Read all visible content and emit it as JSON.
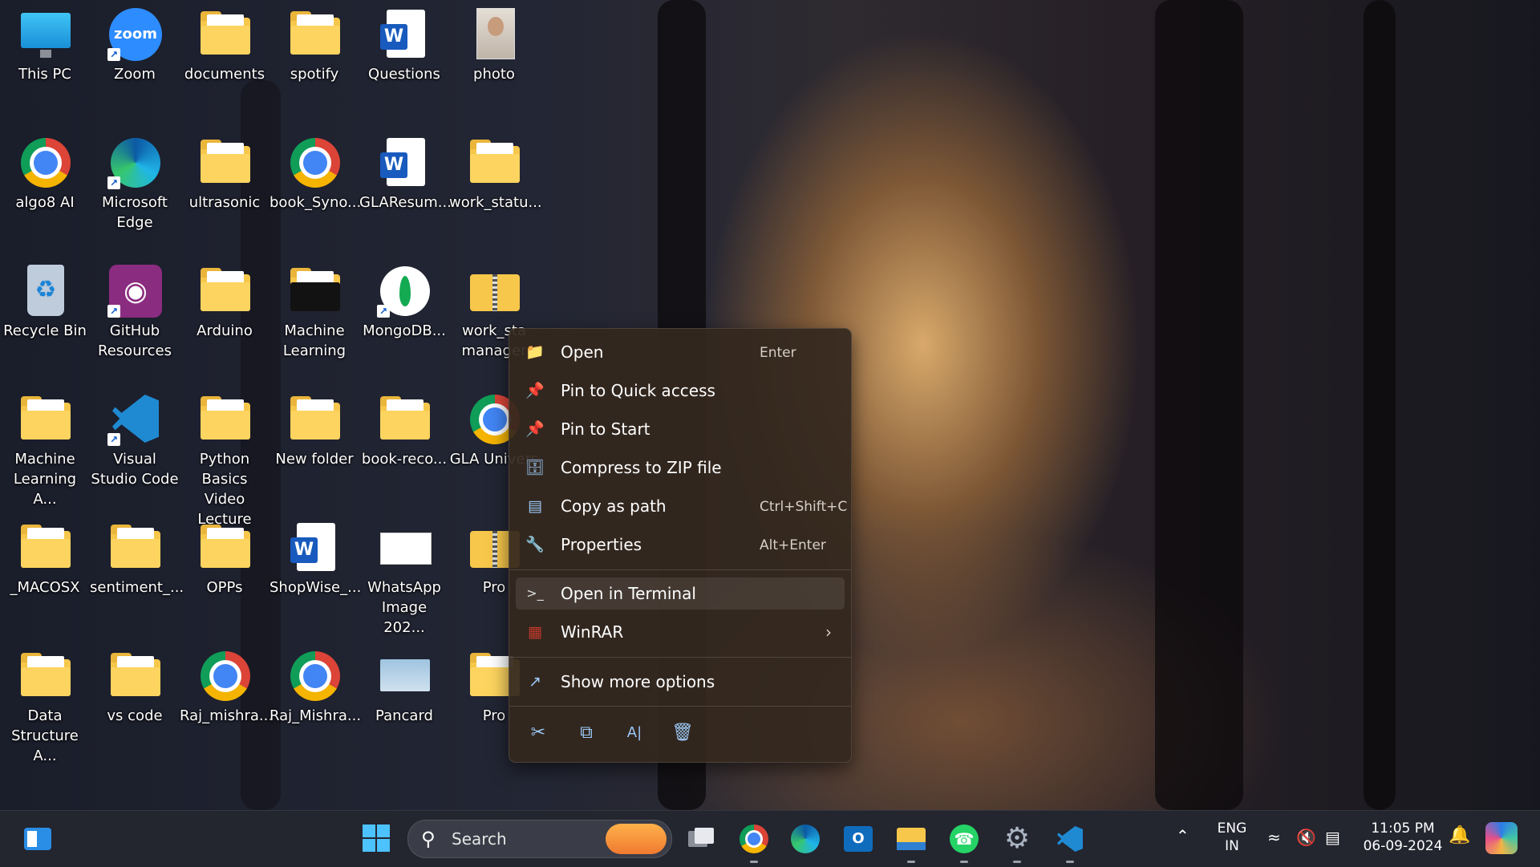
{
  "desktop": {
    "icons": [
      {
        "label": "This PC",
        "icon": "this-pc-icon",
        "shortcut": false
      },
      {
        "label": "Zoom",
        "icon": "zoom-icon",
        "shortcut": true
      },
      {
        "label": "documents",
        "icon": "folder-icon",
        "shortcut": false
      },
      {
        "label": "spotify",
        "icon": "folder-icon",
        "shortcut": false
      },
      {
        "label": "Questions",
        "icon": "word-document-icon",
        "shortcut": false
      },
      {
        "label": "photo",
        "icon": "image-file-icon",
        "shortcut": false
      },
      {
        "label": "algo8 AI",
        "icon": "chrome-icon",
        "shortcut": false
      },
      {
        "label": "Microsoft Edge",
        "icon": "edge-icon",
        "shortcut": true
      },
      {
        "label": "ultrasonic",
        "icon": "folder-icon",
        "shortcut": false
      },
      {
        "label": "book_Syno...",
        "icon": "chrome-icon",
        "shortcut": false
      },
      {
        "label": "GLAResum...",
        "icon": "word-document-icon",
        "shortcut": false
      },
      {
        "label": "work_statu...",
        "icon": "folder-icon",
        "shortcut": false
      },
      {
        "label": "Recycle Bin",
        "icon": "recycle-bin-icon",
        "shortcut": false
      },
      {
        "label": "GitHub Resources",
        "icon": "github-icon",
        "shortcut": true
      },
      {
        "label": "Arduino",
        "icon": "folder-icon",
        "shortcut": false
      },
      {
        "label": "Machine Learning",
        "icon": "folder-icon",
        "shortcut": false
      },
      {
        "label": "MongoDB...",
        "icon": "mongodb-icon",
        "shortcut": true
      },
      {
        "label": "work_sta manager",
        "icon": "zip-folder-icon",
        "shortcut": false
      },
      {
        "label": "Machine Learning A...",
        "icon": "folder-icon",
        "shortcut": false
      },
      {
        "label": "Visual Studio Code",
        "icon": "vscode-icon",
        "shortcut": true
      },
      {
        "label": "Python Basics Video Lecture",
        "icon": "folder-icon",
        "shortcut": false
      },
      {
        "label": "New folder",
        "icon": "folder-icon",
        "shortcut": false
      },
      {
        "label": "book-reco...",
        "icon": "folder-icon",
        "shortcut": false
      },
      {
        "label": "GLA Univers",
        "icon": "chrome-icon",
        "shortcut": false
      },
      {
        "label": "_MACOSX",
        "icon": "folder-icon",
        "shortcut": false
      },
      {
        "label": "sentiment_...",
        "icon": "folder-icon",
        "shortcut": false
      },
      {
        "label": "OPPs",
        "icon": "folder-icon",
        "shortcut": false
      },
      {
        "label": "ShopWise_...",
        "icon": "word-document-icon",
        "shortcut": false
      },
      {
        "label": "WhatsApp Image 202...",
        "icon": "image-file-icon",
        "shortcut": false
      },
      {
        "label": "Pro",
        "icon": "zip-folder-icon",
        "shortcut": false
      },
      {
        "label": "Data Structure A...",
        "icon": "folder-icon",
        "shortcut": false
      },
      {
        "label": "vs code",
        "icon": "folder-icon",
        "shortcut": false
      },
      {
        "label": "Raj_mishra...",
        "icon": "chrome-icon",
        "shortcut": false
      },
      {
        "label": "Raj_Mishra...",
        "icon": "chrome-icon",
        "shortcut": false
      },
      {
        "label": "Pancard",
        "icon": "image-file-icon",
        "shortcut": false
      },
      {
        "label": "Pro",
        "icon": "folder-icon",
        "shortcut": false
      }
    ]
  },
  "context_menu": {
    "items": [
      {
        "label": "Open",
        "shortcut": "Enter",
        "icon": "folder-open-icon"
      },
      {
        "label": "Pin to Quick access",
        "shortcut": "",
        "icon": "pin-icon"
      },
      {
        "label": "Pin to Start",
        "shortcut": "",
        "icon": "pin-icon"
      },
      {
        "label": "Compress to ZIP file",
        "shortcut": "",
        "icon": "zip-compress-icon"
      },
      {
        "label": "Copy as path",
        "shortcut": "Ctrl+Shift+C",
        "icon": "copy-path-icon"
      },
      {
        "label": "Properties",
        "shortcut": "Alt+Enter",
        "icon": "wrench-icon"
      },
      {
        "label": "Open in Terminal",
        "shortcut": "",
        "icon": "terminal-icon"
      },
      {
        "label": "WinRAR",
        "shortcut": "",
        "icon": "winrar-icon"
      },
      {
        "label": "Show more options",
        "shortcut": "",
        "icon": "show-more-icon"
      }
    ],
    "highlighted": "Open in Terminal",
    "quick_actions": [
      "cut-icon",
      "copy-icon",
      "rename-icon",
      "delete-icon"
    ]
  },
  "taskbar": {
    "search_placeholder": "Search",
    "apps": [
      "widgets-icon",
      "start-icon",
      "task-view-icon",
      "chrome-icon",
      "edge-icon",
      "outlook-icon",
      "file-explorer-icon",
      "whatsapp-icon",
      "settings-icon",
      "vscode-icon"
    ],
    "tray": {
      "language_top": "ENG",
      "language_bottom": "IN",
      "time": "11:05 PM",
      "date": "06-09-2024"
    }
  },
  "colors": {
    "menu_bg": "#34281e",
    "taskbar_bg": "#1c1e28",
    "accent_blue": "#9bc8f5"
  }
}
